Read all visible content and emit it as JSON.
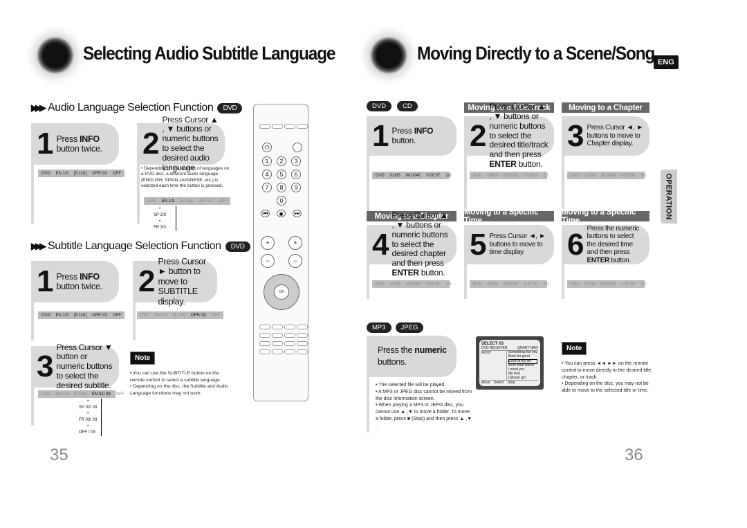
{
  "left": {
    "title": "Selecting Audio Subtitle Language",
    "page": "35",
    "audio": {
      "heading": "Audio Language Selection Function",
      "badge": "DVD",
      "step1": {
        "n": "1",
        "pre": "Press ",
        "bold": "INFO",
        "post": " button twice."
      },
      "step2": {
        "n": "2",
        "text": "Press Cursor ▲ , ▼ buttons or numeric buttons to select the desired audio language."
      },
      "bullet": "Depending on the number of languages on a DVD disc, a different audio language (ENGLISH, SPAIN,JAPANESE, etc.) is selected each time the button is pressed.",
      "bar": [
        "DVD",
        "EN 1/3",
        "[5.1ch]",
        "OFF/ 02",
        "OFF"
      ],
      "options": [
        "SP 2/3",
        "FR 3/3"
      ]
    },
    "subtitle": {
      "heading": "Subtitle Language Selection Function",
      "badge": "DVD",
      "step1": {
        "n": "1",
        "pre": "Press ",
        "bold": "INFO",
        "post": " button twice."
      },
      "step2": {
        "n": "2",
        "text": "Press Cursor ► button to move to SUBTITLE display."
      },
      "step3": {
        "n": "3",
        "text": "Press Cursor ▼ button or numeric buttons to select the desired subtitle."
      },
      "bar": [
        "DVD",
        "EN 1/3",
        "[5.1ch]",
        "OFF/ 02",
        "OFF"
      ],
      "bar3": [
        "DVD",
        "EN 1/3",
        "[5.1ch]",
        "EN 01/ 03",
        "OFF"
      ],
      "options": [
        "SP 02/ 03",
        "FR 03/ 03",
        "OFF / 03"
      ],
      "note_label": "Note",
      "notes": [
        "You can use the SUBTITLE button on the remote control to select a subtitle language.",
        "Depending on the disc, the Subtitle and Audio Language functions may not work."
      ]
    }
  },
  "right": {
    "title": "Moving Directly to a Scene/Song",
    "lang": "ENG",
    "page": "36",
    "tab": "OPERATION",
    "badges": [
      "DVD",
      "CD"
    ],
    "steps": [
      {
        "header": "",
        "n": "1",
        "pre": "Press ",
        "bold": "INFO",
        "post": " button.",
        "bar": [
          "DVD",
          "01/05",
          "001/040",
          "0:00:37",
          "1/1"
        ]
      },
      {
        "header": "Moving to a Title/Track",
        "n": "2",
        "pre": "Press Cursor ▲ , ▼ buttons or numeric buttons to select the desired title/track and then press ",
        "bold": "ENTER",
        "post": " button.",
        "bar": [
          "DVD",
          "03/05",
          "001/002",
          "0:00:01",
          "1/1"
        ]
      },
      {
        "header": "Moving to a Chapter",
        "n": "3",
        "pre": "Press Cursor ◄, ► buttons to move to Chapter display.",
        "bold": "",
        "post": "",
        "bar": [
          "DVD",
          "01/05",
          "001/040",
          "0:00:01",
          "1/1"
        ]
      },
      {
        "header": "Moving to a Chapter",
        "n": "4",
        "pre": "Press Cursor ▲ , ▼ buttons or numeric buttons to select the desired chapter and then press ",
        "bold": "ENTER",
        "post": " button.",
        "bar": [
          "DVD",
          "01/05",
          "025/040",
          "0:00:01",
          "1/1"
        ]
      },
      {
        "header": "Moving to a Specific Time",
        "n": "5",
        "pre": "Press Cursor ◄, ► buttons to move to time display.",
        "bold": "",
        "post": "",
        "bar": [
          "DVD",
          "01/05",
          "025/040",
          "1:17:30",
          "1/1"
        ]
      },
      {
        "header": "Moving to a Specific Time",
        "n": "6",
        "pre": "Press the numeric buttons to select the desired time and then press ",
        "bold": "ENTER",
        "post": " button.",
        "bar": [
          "DVD",
          "01/05",
          "028/040",
          "1:30:00",
          "1/1"
        ]
      }
    ],
    "mp3": {
      "badges": [
        "MP3",
        "JPEG"
      ],
      "pre": "Press the ",
      "bold": "numeric",
      "post": " buttons.",
      "bullets": [
        "The selected file will be played.",
        "A MP3 or JPEG disc cannot be moved from the disc information screen.",
        "When playing a MP3 or JEPG disc, you cannot use ▲ ,▼  to move a folder. To move a folder, press ■ (Stop) and then press ▲ ,▼ ."
      ],
      "screen": {
        "title": "SELECT 03",
        "left": "DVD RECEIVER",
        "right": "SMART NAVI",
        "root": "ROOT",
        "files": [
          "Something like you",
          "Back for good",
          "Love of my life",
          "More than words",
          "I need you",
          "My love",
          "Uptown girl"
        ],
        "footer": [
          "Move",
          "Select",
          "Stop"
        ]
      }
    },
    "note_label": "Note",
    "notes": [
      "You can press ◄◄ ►► on the remote control to move directly to the desired title, chapter, or track.",
      "Depending on the disc, you may not be able to move to the selected title or time."
    ]
  }
}
